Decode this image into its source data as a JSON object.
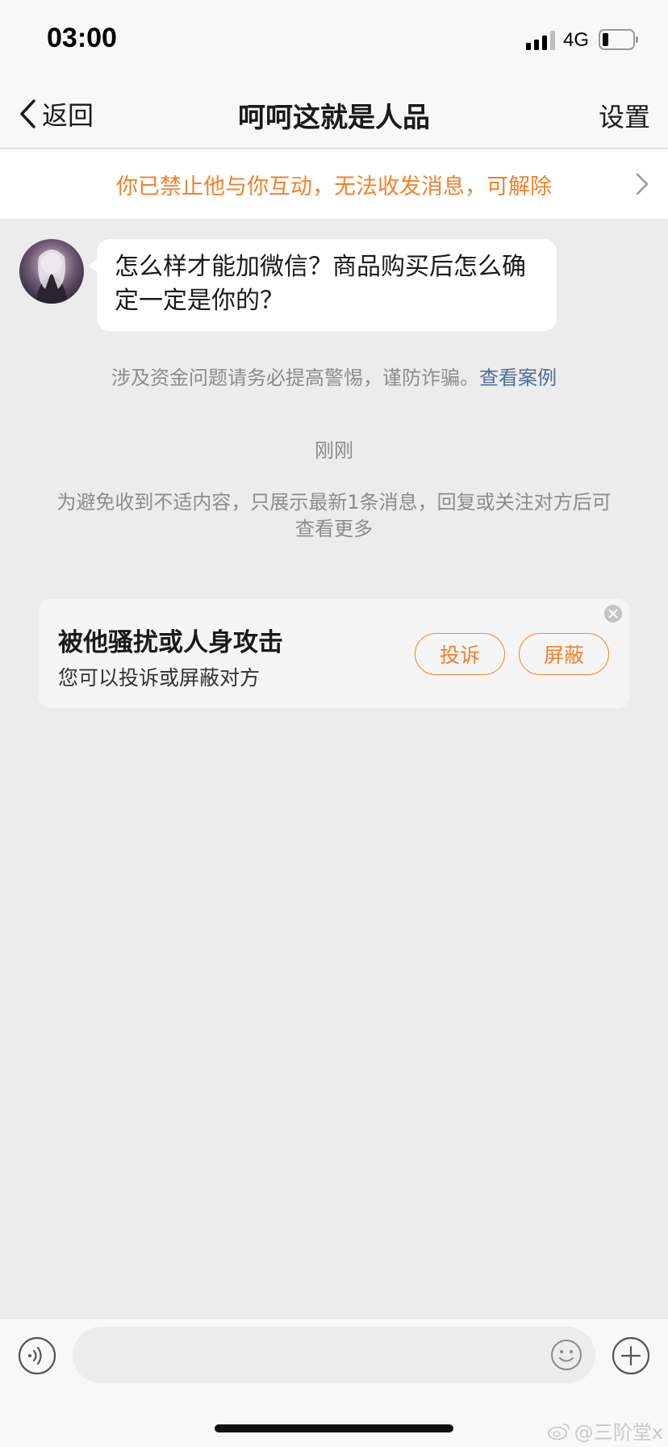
{
  "status_bar": {
    "time": "03:00",
    "network": "4G",
    "signal_icon": "signal-bars-icon",
    "battery_icon": "battery-low-icon"
  },
  "nav": {
    "back_label": "返回",
    "title": "呵呵这就是人品",
    "settings_label": "设置",
    "back_icon": "chevron-left-icon"
  },
  "block_notice": {
    "text": "你已禁止他与你互动，无法收发消息，可解除",
    "chevron_icon": "chevron-right-icon",
    "color": "#f0822d"
  },
  "message": {
    "text": "怎么样才能加微信？商品购买后怎么确定一定是你的？",
    "avatar": "user-avatar"
  },
  "fraud_warning": {
    "text": "涉及资金问题请务必提高警惕，谨防诈骗。",
    "link": "查看案例",
    "link_color": "#4e6e96"
  },
  "timestamp": "刚刚",
  "filter_notice": "为避免收到不适内容，只展示最新1条消息，回复或关注对方后可查看更多",
  "harassment_card": {
    "title": "被他骚扰或人身攻击",
    "subtitle": "您可以投诉或屏蔽对方",
    "complain_label": "投诉",
    "block_label": "屏蔽",
    "close_icon": "close-circle-icon"
  },
  "input_bar": {
    "placeholder": "",
    "voice_icon": "voice-icon",
    "emoji_icon": "emoji-icon",
    "plus_icon": "plus-icon"
  },
  "watermark": {
    "text": "@三阶堂x",
    "icon": "weibo-icon"
  }
}
